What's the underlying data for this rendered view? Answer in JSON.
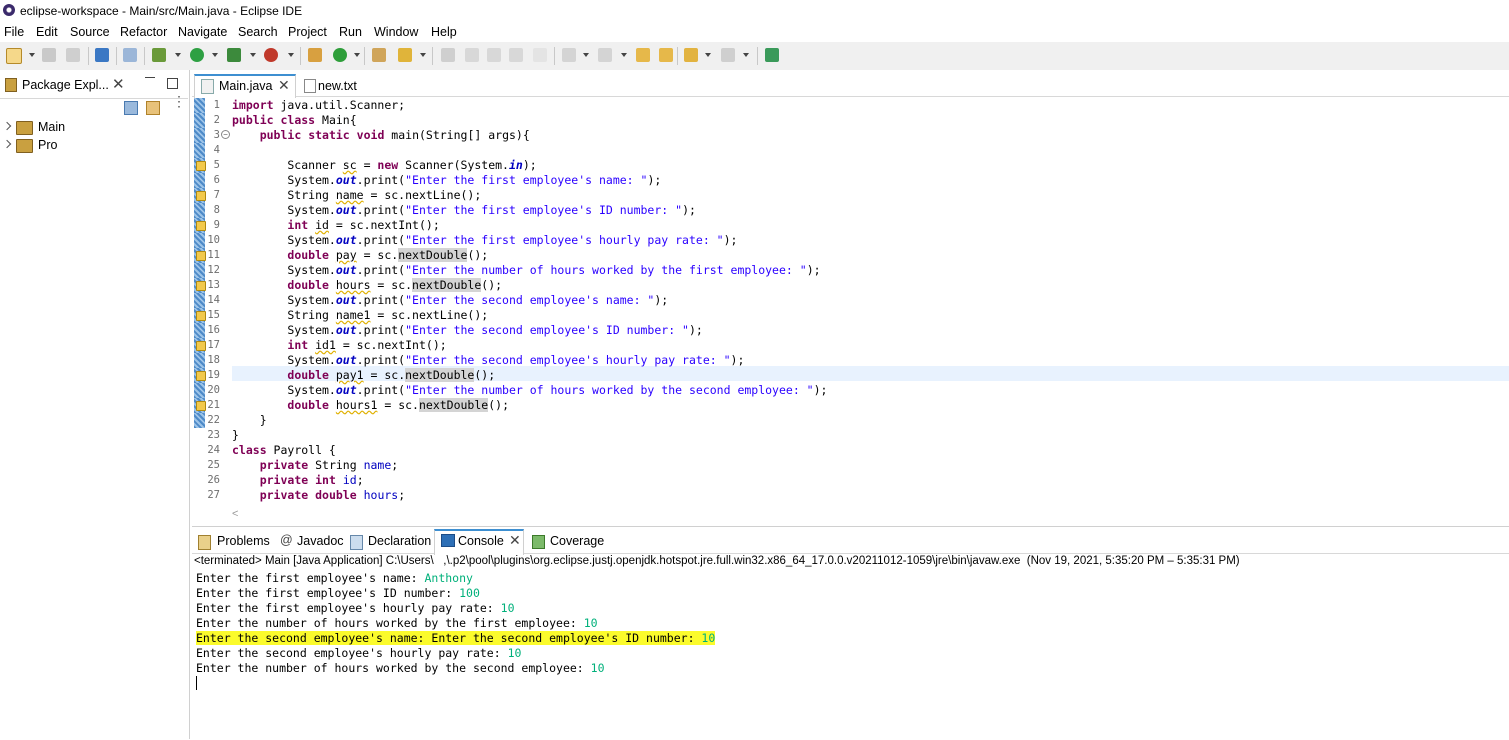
{
  "window": {
    "title": "eclipse-workspace - Main/src/Main.java - Eclipse IDE"
  },
  "menu": [
    "File",
    "Edit",
    "Source",
    "Refactor",
    "Navigate",
    "Search",
    "Project",
    "Run",
    "Window",
    "Help"
  ],
  "package_explorer": {
    "tab_label": "Package Expl...",
    "items": [
      "Main",
      "Pro"
    ]
  },
  "editor": {
    "tabs": [
      "Main.java",
      "new.txt"
    ],
    "lines": [
      {
        "n": "1",
        "text": "import java.util.Scanner;"
      },
      {
        "n": "2",
        "text": "public class Main{"
      },
      {
        "n": "3",
        "text": "    public static void main(String[] args){"
      },
      {
        "n": "4",
        "text": ""
      },
      {
        "n": "5",
        "text": "        Scanner sc = new Scanner(System.in);"
      },
      {
        "n": "6",
        "text": "        System.out.print(\"Enter the first employee's name: \");"
      },
      {
        "n": "7",
        "text": "        String name = sc.nextLine();"
      },
      {
        "n": "8",
        "text": "        System.out.print(\"Enter the first employee's ID number: \");"
      },
      {
        "n": "9",
        "text": "        int id = sc.nextInt();"
      },
      {
        "n": "10",
        "text": "        System.out.print(\"Enter the first employee's hourly pay rate: \");"
      },
      {
        "n": "11",
        "text": "        double pay = sc.nextDouble();"
      },
      {
        "n": "12",
        "text": "        System.out.print(\"Enter the number of hours worked by the first employee: \");"
      },
      {
        "n": "13",
        "text": "        double hours = sc.nextDouble();"
      },
      {
        "n": "14",
        "text": "        System.out.print(\"Enter the second employee's name: \");"
      },
      {
        "n": "15",
        "text": "        String name1 = sc.nextLine();"
      },
      {
        "n": "16",
        "text": "        System.out.print(\"Enter the second employee's ID number: \");"
      },
      {
        "n": "17",
        "text": "        int id1 = sc.nextInt();"
      },
      {
        "n": "18",
        "text": "        System.out.print(\"Enter the second employee's hourly pay rate: \");"
      },
      {
        "n": "19",
        "text": "        double pay1 = sc.nextDouble();"
      },
      {
        "n": "20",
        "text": "        System.out.print(\"Enter the number of hours worked by the second employee: \");"
      },
      {
        "n": "21",
        "text": "        double hours1 = sc.nextDouble();"
      },
      {
        "n": "22",
        "text": "    }"
      },
      {
        "n": "23",
        "text": "}"
      },
      {
        "n": "24",
        "text": "class Payroll {"
      },
      {
        "n": "25",
        "text": "    private String name;"
      },
      {
        "n": "26",
        "text": "    private int id;"
      },
      {
        "n": "27",
        "text": "    private double hours;"
      }
    ]
  },
  "bottom_panel": {
    "tabs": [
      "Problems",
      "Javadoc",
      "Declaration",
      "Console",
      "Coverage"
    ],
    "active_tab": "Console",
    "console_header": "<terminated> Main [Java Application] C:\\Users\\   ,\\.p2\\pool\\plugins\\org.eclipse.justj.openjdk.hotspot.jre.full.win32.x86_64_17.0.0.v20211012-1059\\jre\\bin\\javaw.exe  (Nov 19, 2021, 5:35:20 PM – 5:35:31 PM)",
    "console_lines": [
      {
        "prompt": "Enter the first employee's name: ",
        "input": "Anthony",
        "highlight": false
      },
      {
        "prompt": "Enter the first employee's ID number: ",
        "input": "100",
        "highlight": false
      },
      {
        "prompt": "Enter the first employee's hourly pay rate: ",
        "input": "10",
        "highlight": false
      },
      {
        "prompt": "Enter the number of hours worked by the first employee: ",
        "input": "10",
        "highlight": false
      },
      {
        "prompt": "Enter the second employee's name: Enter the second employee's ID number: ",
        "input": "10",
        "highlight": true
      },
      {
        "prompt": "Enter the second employee's hourly pay rate: ",
        "input": "10",
        "highlight": false
      },
      {
        "prompt": "Enter the number of hours worked by the second employee: ",
        "input": "10",
        "highlight": false
      }
    ]
  },
  "colors": {
    "keyword": "#7f0055",
    "string": "#2a00ff",
    "console_input": "#00b07a",
    "highlight": "#fbfb2c",
    "active_tab_accent": "#3d8fd1"
  }
}
